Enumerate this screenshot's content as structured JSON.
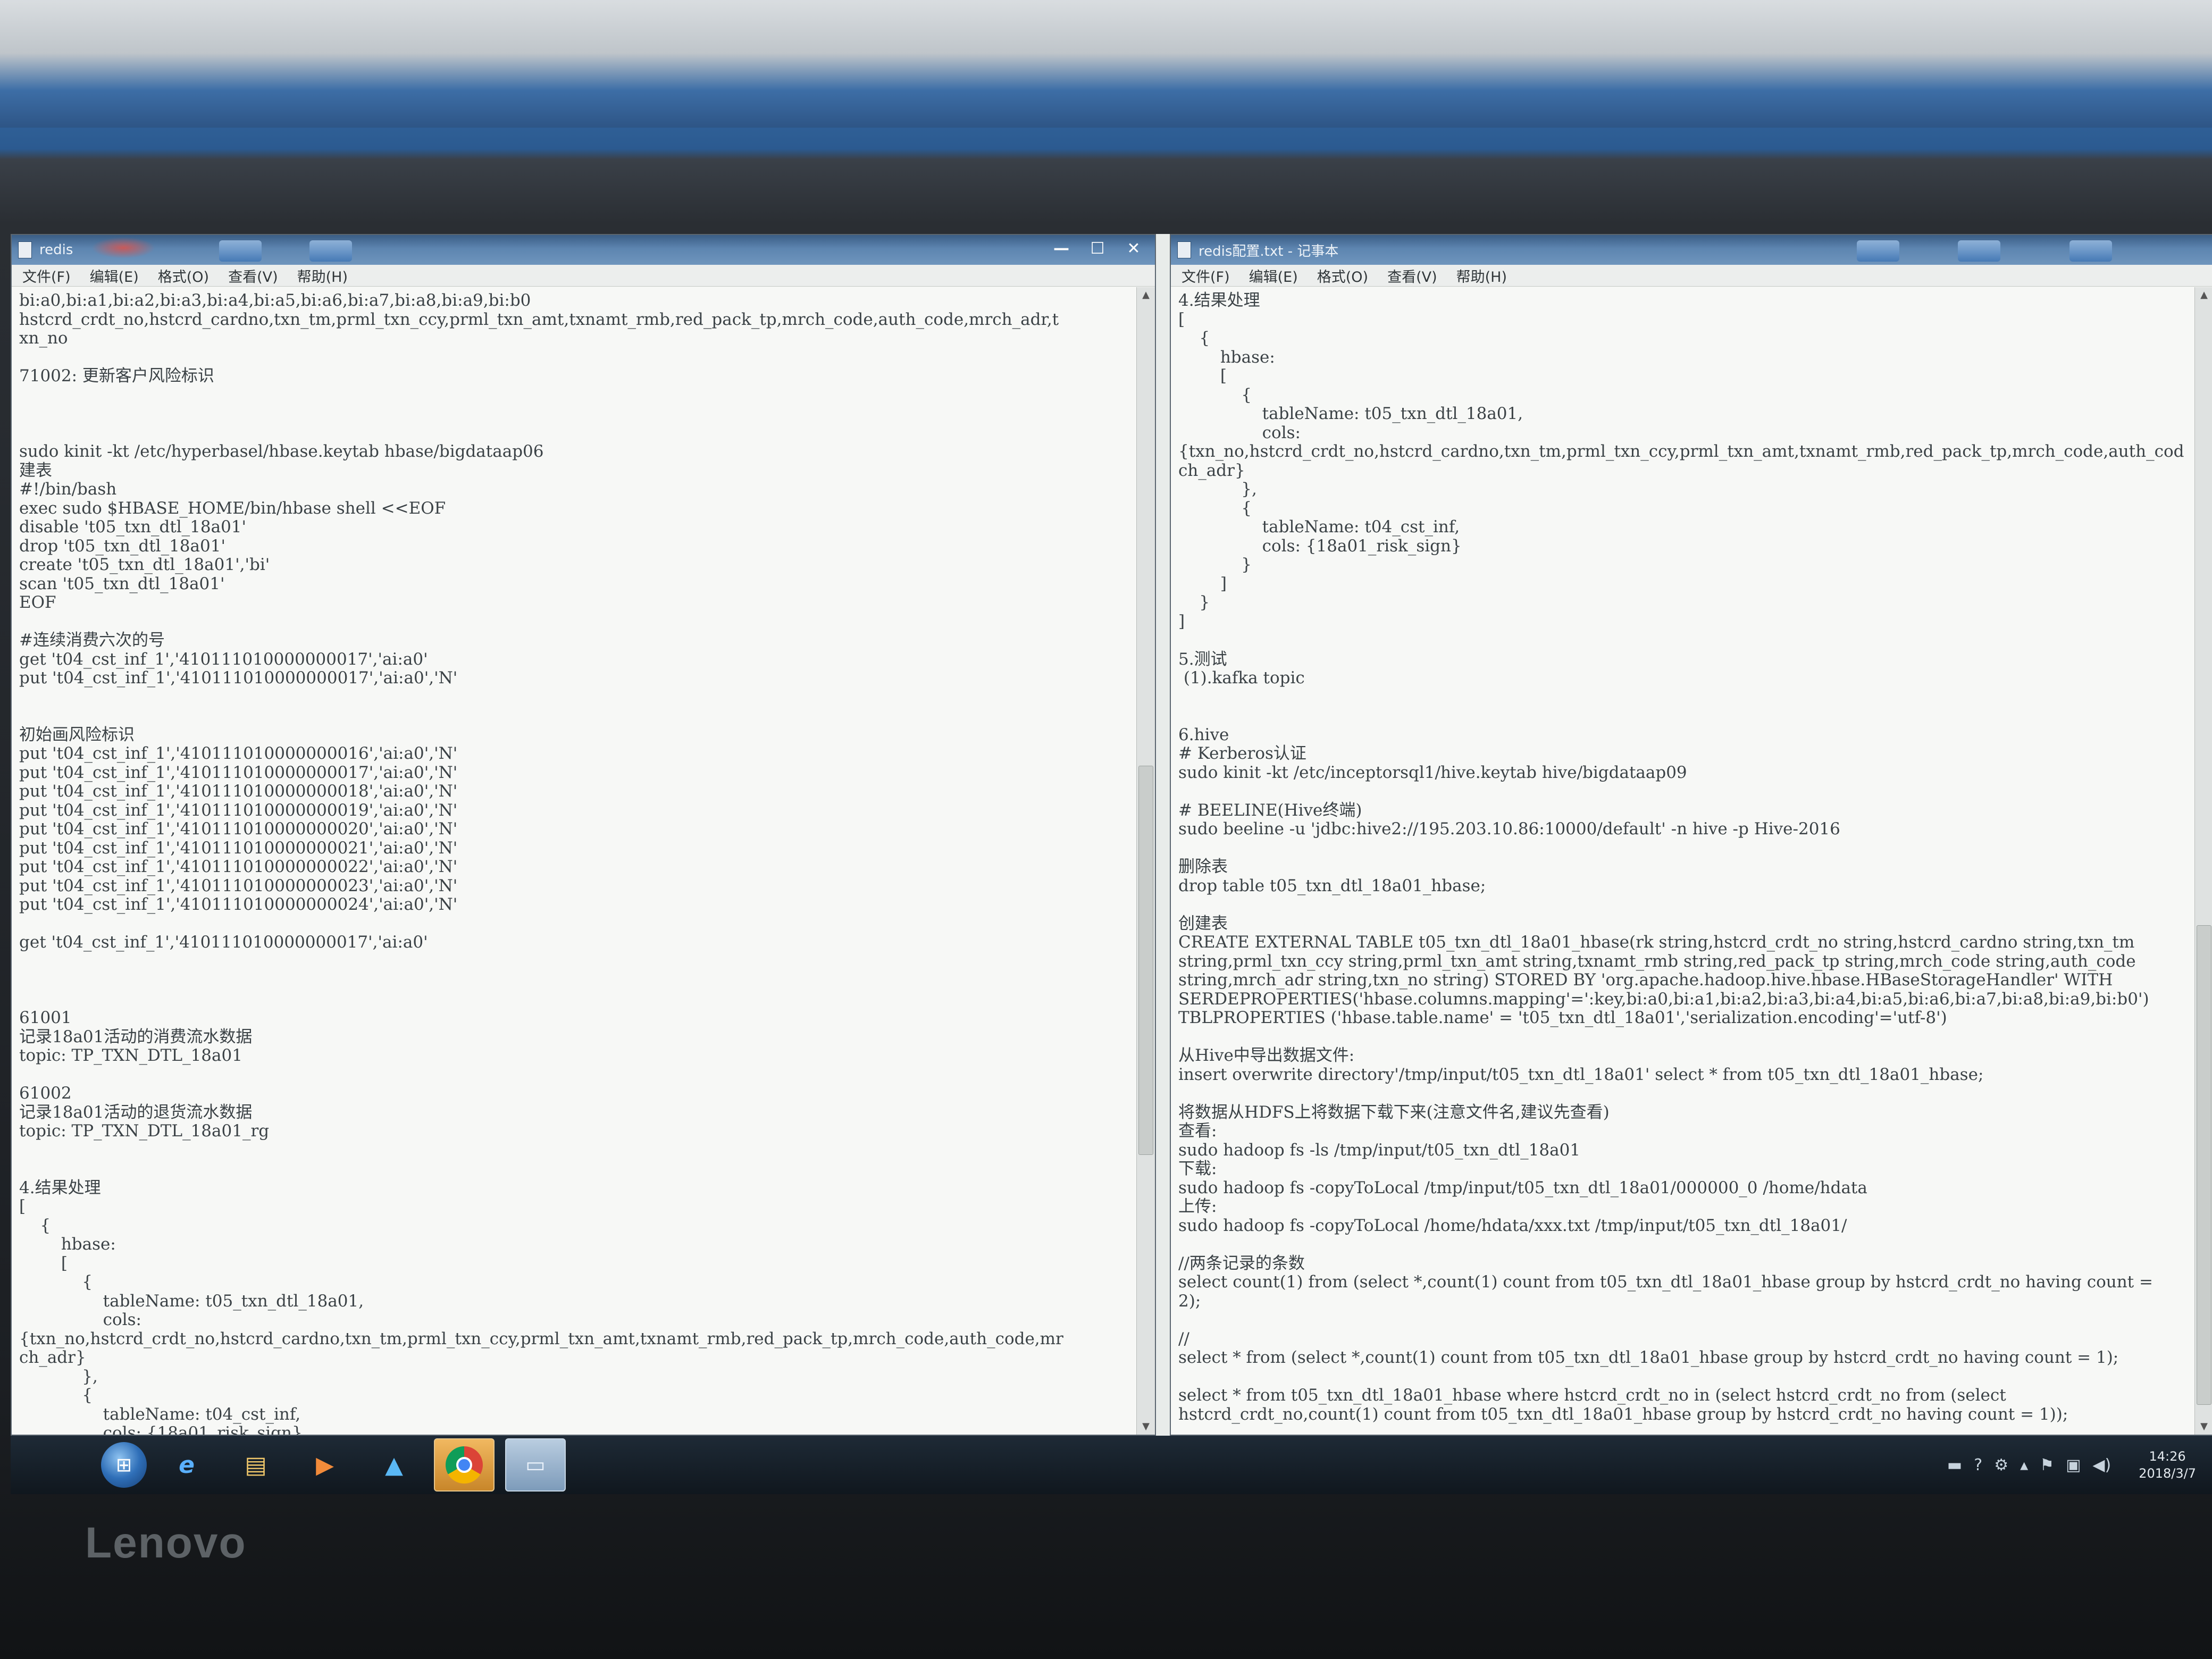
{
  "left_window": {
    "title": "redis",
    "controls": {
      "minimize": "—",
      "maximize": "☐",
      "close": "✕"
    },
    "menu": [
      "文件(F)",
      "编辑(E)",
      "格式(O)",
      "查看(V)",
      "帮助(H)"
    ],
    "lines": [
      "bi:a0,bi:a1,bi:a2,bi:a3,bi:a4,bi:a5,bi:a6,bi:a7,bi:a8,bi:a9,bi:b0",
      "hstcrd_crdt_no,hstcrd_cardno,txn_tm,prml_txn_ccy,prml_txn_amt,txnamt_rmb,red_pack_tp,mrch_code,auth_code,mrch_adr,t",
      "xn_no",
      "",
      "71002: 更新客户风险标识",
      "",
      "",
      "",
      "sudo kinit -kt /etc/hyperbasel/hbase.keytab hbase/bigdataap06",
      "建表",
      "#!/bin/bash",
      "exec sudo $HBASE_HOME/bin/hbase shell <<EOF",
      "disable 't05_txn_dtl_18a01'",
      "drop 't05_txn_dtl_18a01'",
      "create 't05_txn_dtl_18a01','bi'",
      "scan 't05_txn_dtl_18a01'",
      "EOF",
      "",
      "#连续消费六次的号",
      "get 't04_cst_inf_1','410111010000000017','ai:a0'",
      "put 't04_cst_inf_1','410111010000000017','ai:a0','N'",
      "",
      "",
      "初始画风险标识",
      "put 't04_cst_inf_1','410111010000000016','ai:a0','N'",
      "put 't04_cst_inf_1','410111010000000017','ai:a0','N'",
      "put 't04_cst_inf_1','410111010000000018','ai:a0','N'",
      "put 't04_cst_inf_1','410111010000000019','ai:a0','N'",
      "put 't04_cst_inf_1','410111010000000020','ai:a0','N'",
      "put 't04_cst_inf_1','410111010000000021','ai:a0','N'",
      "put 't04_cst_inf_1','410111010000000022','ai:a0','N'",
      "put 't04_cst_inf_1','410111010000000023','ai:a0','N'",
      "put 't04_cst_inf_1','410111010000000024','ai:a0','N'",
      "",
      "get 't04_cst_inf_1','410111010000000017','ai:a0'",
      "",
      "",
      "",
      "61001",
      "记录18a01活动的消费流水数据",
      "topic: TP_TXN_DTL_18a01",
      "",
      "61002",
      "记录18a01活动的退货流水数据",
      "topic: TP_TXN_DTL_18a01_rg",
      "",
      "",
      "4.结果处理",
      "[",
      "    {",
      "        hbase:",
      "        [",
      "            {",
      "                tableName: t05_txn_dtl_18a01,",
      "                cols:",
      "{txn_no,hstcrd_crdt_no,hstcrd_cardno,txn_tm,prml_txn_ccy,prml_txn_amt,txnamt_rmb,red_pack_tp,mrch_code,auth_code,mr",
      "ch_adr}",
      "            },",
      "            {",
      "                tableName: t04_cst_inf,",
      "                cols: {18a01_risk_sign}"
    ]
  },
  "right_window": {
    "title": "redis配置.txt - 记事本",
    "menu": [
      "文件(F)",
      "编辑(E)",
      "格式(O)",
      "查看(V)",
      "帮助(H)"
    ],
    "lines": [
      "4.结果处理",
      "[",
      "    {",
      "        hbase:",
      "        [",
      "            {",
      "                tableName: t05_txn_dtl_18a01,",
      "                cols:",
      "{txn_no,hstcrd_crdt_no,hstcrd_cardno,txn_tm,prml_txn_ccy,prml_txn_amt,txnamt_rmb,red_pack_tp,mrch_code,auth_cod",
      "ch_adr}",
      "            },",
      "            {",
      "                tableName: t04_cst_inf,",
      "                cols: {18a01_risk_sign}",
      "            }",
      "        ]",
      "    }",
      "]",
      "",
      "5.测试",
      " (1).kafka topic",
      "",
      "",
      "6.hive",
      "# Kerberos认证",
      "sudo kinit -kt /etc/inceptorsql1/hive.keytab hive/bigdataap09",
      "",
      "# BEELINE(Hive终端)",
      "sudo beeline -u 'jdbc:hive2://195.203.10.86:10000/default' -n hive -p Hive-2016",
      "",
      "删除表",
      "drop table t05_txn_dtl_18a01_hbase;",
      "",
      "创建表",
      "CREATE EXTERNAL TABLE t05_txn_dtl_18a01_hbase(rk string,hstcrd_crdt_no string,hstcrd_cardno string,txn_tm",
      "string,prml_txn_ccy string,prml_txn_amt string,txnamt_rmb string,red_pack_tp string,mrch_code string,auth_code",
      "string,mrch_adr string,txn_no string) STORED BY 'org.apache.hadoop.hive.hbase.HBaseStorageHandler' WITH",
      "SERDEPROPERTIES('hbase.columns.mapping'=':key,bi:a0,bi:a1,bi:a2,bi:a3,bi:a4,bi:a5,bi:a6,bi:a7,bi:a8,bi:a9,bi:b0')",
      "TBLPROPERTIES ('hbase.table.name' = 't05_txn_dtl_18a01','serialization.encoding'='utf-8')",
      "",
      "从Hive中导出数据文件:",
      "insert overwrite directory'/tmp/input/t05_txn_dtl_18a01' select * from t05_txn_dtl_18a01_hbase;",
      "",
      "将数据从HDFS上将数据下载下来(注意文件名,建议先查看)",
      "查看:",
      "sudo hadoop fs -ls /tmp/input/t05_txn_dtl_18a01",
      "下载:",
      "sudo hadoop fs -copyToLocal /tmp/input/t05_txn_dtl_18a01/000000_0 /home/hdata",
      "上传:",
      "sudo hadoop fs -copyToLocal /home/hdata/xxx.txt /tmp/input/t05_txn_dtl_18a01/",
      "",
      "//两条记录的条数",
      "select count(1) from (select *,count(1) count from t05_txn_dtl_18a01_hbase group by hstcrd_crdt_no having count =",
      "2);",
      "",
      "//",
      "select * from (select *,count(1) count from t05_txn_dtl_18a01_hbase group by hstcrd_crdt_no having count = 1);",
      "",
      "select * from t05_txn_dtl_18a01_hbase where hstcrd_crdt_no in (select hstcrd_crdt_no from (select",
      "hstcrd_crdt_no,count(1) count from t05_txn_dtl_18a01_hbase group by hstcrd_crdt_no having count = 1));"
    ]
  },
  "taskbar": {
    "start_glyph": "⊞",
    "items": [
      {
        "name": "ie",
        "glyph": "e"
      },
      {
        "name": "explorer",
        "glyph": "▤"
      },
      {
        "name": "media",
        "glyph": "▶"
      },
      {
        "name": "upload",
        "glyph": "▲"
      },
      {
        "name": "chrome",
        "glyph": ""
      },
      {
        "name": "notepad",
        "glyph": "▭"
      }
    ],
    "tray_icons": [
      "▬",
      "?",
      "⚙",
      "▴",
      "⚑",
      "▣",
      "◀)"
    ],
    "clock_time": "14:26",
    "clock_date": "2018/3/7"
  },
  "brand": "Lenovo"
}
